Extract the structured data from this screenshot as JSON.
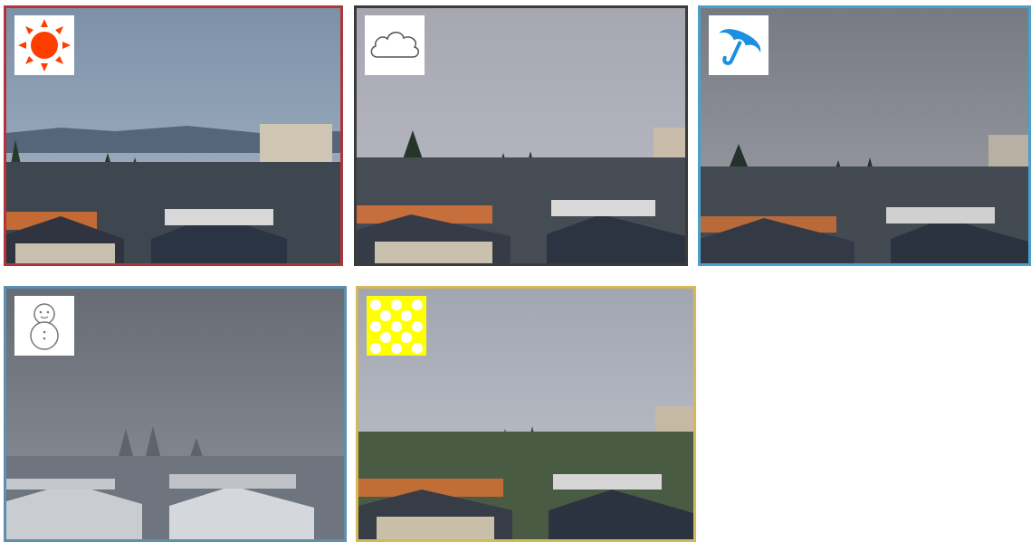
{
  "tiles": [
    {
      "id": "sunny",
      "icon": "sun-icon",
      "sky_top": "#7f93a8",
      "sky_bottom": "#a9b6c6",
      "border": "#b0353a"
    },
    {
      "id": "cloudy",
      "icon": "cloud-icon",
      "sky_top": "#a9aab4",
      "sky_bottom": "#b9bac2",
      "border": "#3b3b3b"
    },
    {
      "id": "rainy",
      "icon": "umbrella-icon",
      "sky_top": "#7c7f86",
      "sky_bottom": "#9ea1a8",
      "border": "#4aa0c8"
    },
    {
      "id": "snowy",
      "icon": "snowman-icon",
      "sky_top": "#6b7078",
      "sky_bottom": "#8e939b",
      "border": "#5d8fb0"
    },
    {
      "id": "pollen",
      "icon": "dots-pattern-icon",
      "sky_top": "#a3a8b3",
      "sky_bottom": "#bfc3cb",
      "border": "#d4b85a"
    }
  ],
  "colors": {
    "sun": "#ff3d00",
    "umbrella": "#1e8fe0",
    "pollen_bg": "#ffff00",
    "pollen_dot": "#ffffff"
  }
}
